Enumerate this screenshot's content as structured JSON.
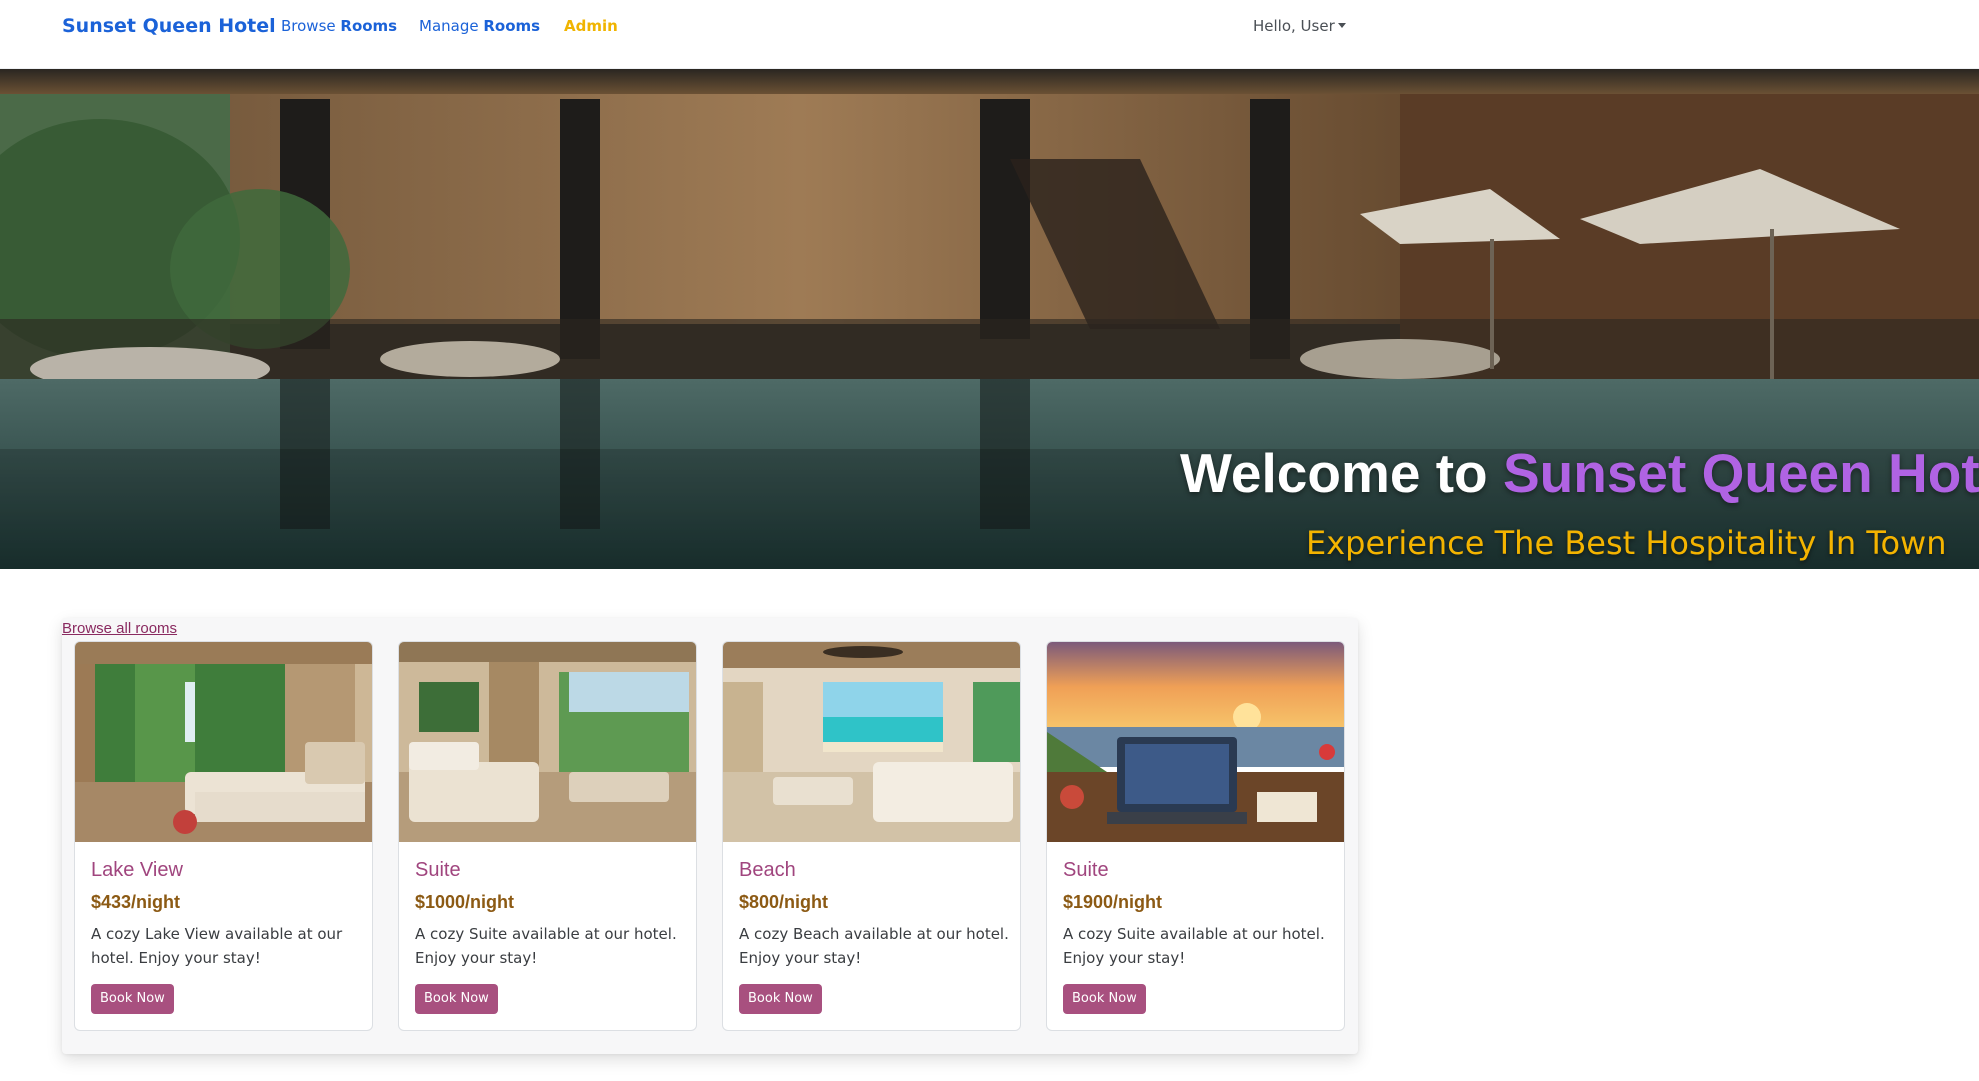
{
  "navbar": {
    "brand": "Sunset Queen Hotel",
    "browse_prefix": "Browse ",
    "browse_bold": "Rooms",
    "manage_prefix": "Manage ",
    "manage_bold": "Rooms",
    "admin": "Admin",
    "user_menu": "Hello, User"
  },
  "hero": {
    "title_prefix": "Welcome to ",
    "title_accent": "Sunset Queen Hotel",
    "subtitle": "Experience The Best Hospitality In Town"
  },
  "rooms": {
    "browse_all": "Browse all rooms",
    "button_label": "Book Now",
    "cards": [
      {
        "title": "Lake View",
        "price": "$433/night",
        "description": "A cozy Lake View available at our hotel. Enjoy your stay!"
      },
      {
        "title": "Suite",
        "price": "$1000/night",
        "description": "A cozy Suite available at our hotel. Enjoy your stay!"
      },
      {
        "title": "Beach",
        "price": "$800/night",
        "description": "A cozy Beach available at our hotel. Enjoy your stay!"
      },
      {
        "title": "Suite",
        "price": "$1900/night",
        "description": "A cozy Suite available at our hotel. Enjoy your stay!"
      }
    ]
  },
  "colors": {
    "brand_blue": "#1b62d8",
    "admin_yellow": "#f0b400",
    "hero_accent": "#b063e3",
    "hero_subtitle": "#f4b400",
    "card_title": "#a0457e",
    "price": "#8c5a14",
    "button": "#a8507f"
  }
}
